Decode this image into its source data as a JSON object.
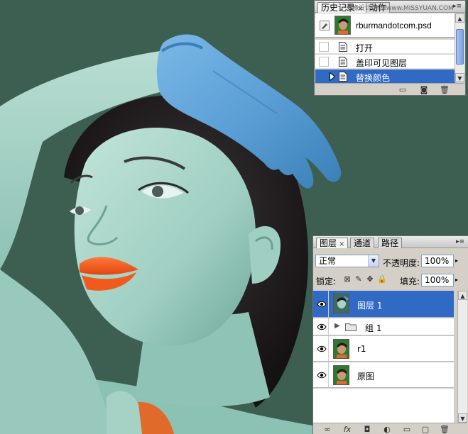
{
  "history_panel": {
    "tabs": [
      {
        "label": "历史记录",
        "close": "×"
      },
      {
        "label": "动作"
      }
    ],
    "overlay_text": "思缘设计论坛 www.MISSYUAN.COM",
    "menu_icon": "panel-menu-icon",
    "snapshot": {
      "name": "rburmandotcom.psd"
    },
    "states": [
      {
        "label": "打开",
        "selected": false
      },
      {
        "label": "盖印可见图层",
        "selected": false
      },
      {
        "label": "替换颜色",
        "selected": true
      }
    ],
    "bottom_icons": [
      "new-document-from-state-icon",
      "new-snapshot-icon",
      "trash-icon"
    ]
  },
  "layers_panel": {
    "tabs": [
      {
        "label": "图层",
        "close": "×"
      },
      {
        "label": "通道"
      },
      {
        "label": "路径"
      }
    ],
    "blend_mode": "正常",
    "opacity_label": "不透明度:",
    "opacity_value": "100%",
    "lock_label": "锁定:",
    "fill_label": "填充:",
    "fill_value": "100%",
    "layers": [
      {
        "name": "图层 1",
        "selected": true,
        "visible": true,
        "type": "layer"
      },
      {
        "name": "组 1",
        "selected": false,
        "visible": true,
        "type": "group"
      },
      {
        "name": "r1",
        "selected": false,
        "visible": true,
        "type": "layer"
      },
      {
        "name": "原图",
        "selected": false,
        "visible": true,
        "type": "layer"
      }
    ],
    "bottom_icons": [
      "link-icon",
      "fx-icon",
      "mask-icon",
      "adjustment-icon",
      "group-folder-icon",
      "new-layer-icon",
      "trash-icon"
    ]
  },
  "colors": {
    "background": "#3d5f52",
    "selection": "#316ac5",
    "glove": "#5b9fd6",
    "lips": "#f2561e",
    "skin": "#9fcfc2"
  }
}
